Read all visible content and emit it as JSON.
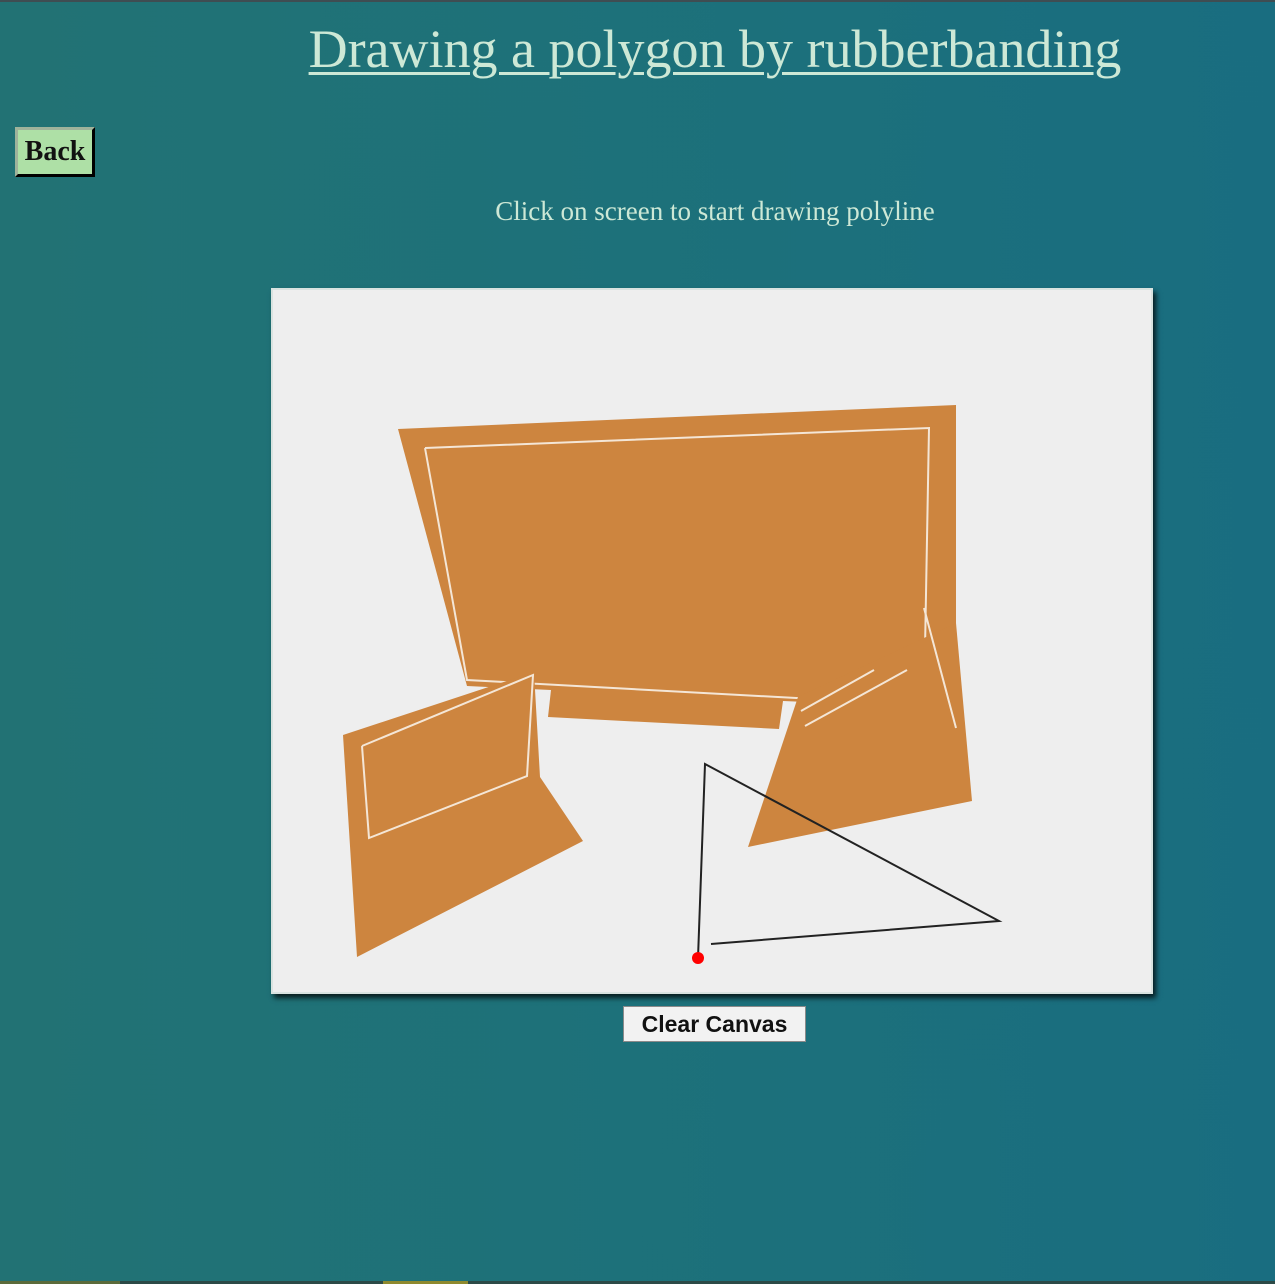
{
  "page": {
    "title": "Drawing a polygon by rubberbanding",
    "instructions": "Click on screen to start drawing polyline"
  },
  "buttons": {
    "back_label": "Back",
    "clear_label": "Clear Canvas"
  },
  "canvas": {
    "background_color": "#eeeeee",
    "polygon_fill_color": "#cd853f",
    "outline_color": "#f4e6d6",
    "rubberband_color": "#222222",
    "cursor_point_color": "#ff0000",
    "polygon_count": 3,
    "rubberband_vertex_count": 4
  },
  "colors": {
    "background": "#1d717a",
    "title_text": "#cde8d6",
    "back_button_bg": "#aee0a6"
  }
}
